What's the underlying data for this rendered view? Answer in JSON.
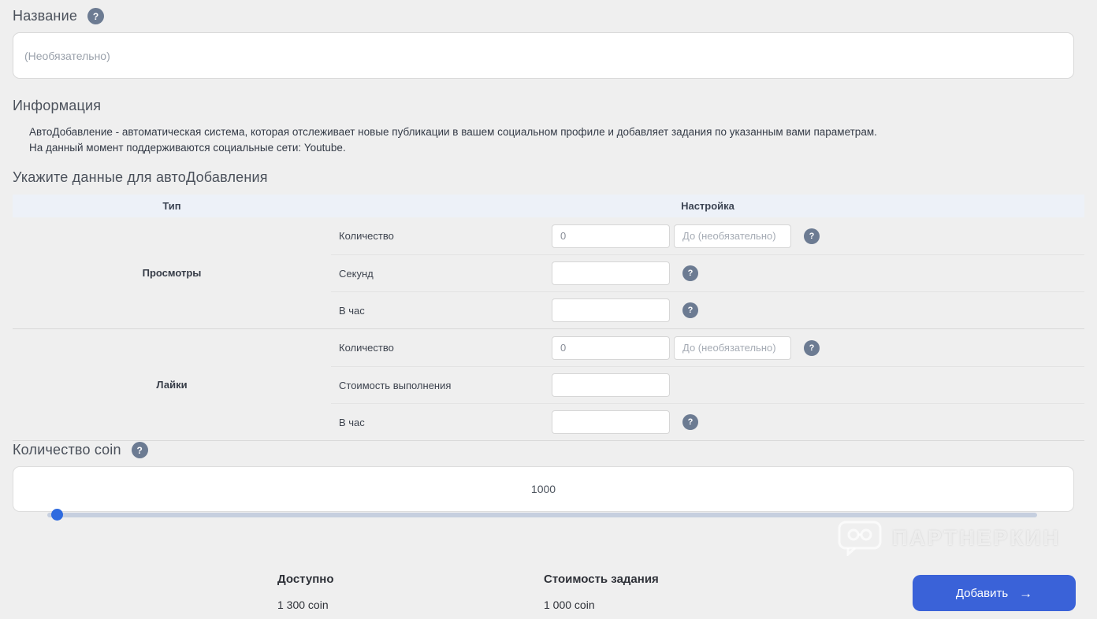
{
  "icons": {
    "question": "?",
    "arrow_right": "→"
  },
  "name_section": {
    "heading": "Название",
    "placeholder": "(Необязательно)"
  },
  "info": {
    "heading": "Информация",
    "line1": "АвтоДобавление - автоматическая система, которая отслеживает новые публикации в вашем социальном профиле и добавляет задания по указанным вами параметрам.",
    "line2": "На данный момент поддерживаются социальные сети: Youtube."
  },
  "auto_table": {
    "heading": "Укажите данные для автоДобавления",
    "columns": {
      "type": "Тип",
      "settings": "Настройка"
    },
    "groups": [
      {
        "name": "Просмотры",
        "rows": [
          {
            "label": "Количество",
            "value": "0",
            "placeholder_to": "До (необязательно)"
          },
          {
            "label": "Секунд"
          },
          {
            "label": "В час"
          }
        ]
      },
      {
        "name": "Лайки",
        "rows": [
          {
            "label": "Количество",
            "value": "0",
            "placeholder_to": "До (необязательно)"
          },
          {
            "label": "Стоимость выполнения"
          },
          {
            "label": "В час"
          }
        ]
      }
    ]
  },
  "coin": {
    "heading": "Количество coin",
    "value": "1000"
  },
  "footer": {
    "available_label": "Доступно",
    "available_value": "1 300 coin",
    "cost_label": "Стоимость задания",
    "cost_value": "1 000 coin",
    "submit_label": "Добавить"
  },
  "watermark": {
    "text": "ПАРТНЕРКИН"
  },
  "colors": {
    "page_bg": "#efefef",
    "accent_blue": "#3a62d8",
    "slider_thumb": "#2f6bdf",
    "help_icon": "#6c7b92",
    "table_header_bg": "#edf1f8"
  }
}
